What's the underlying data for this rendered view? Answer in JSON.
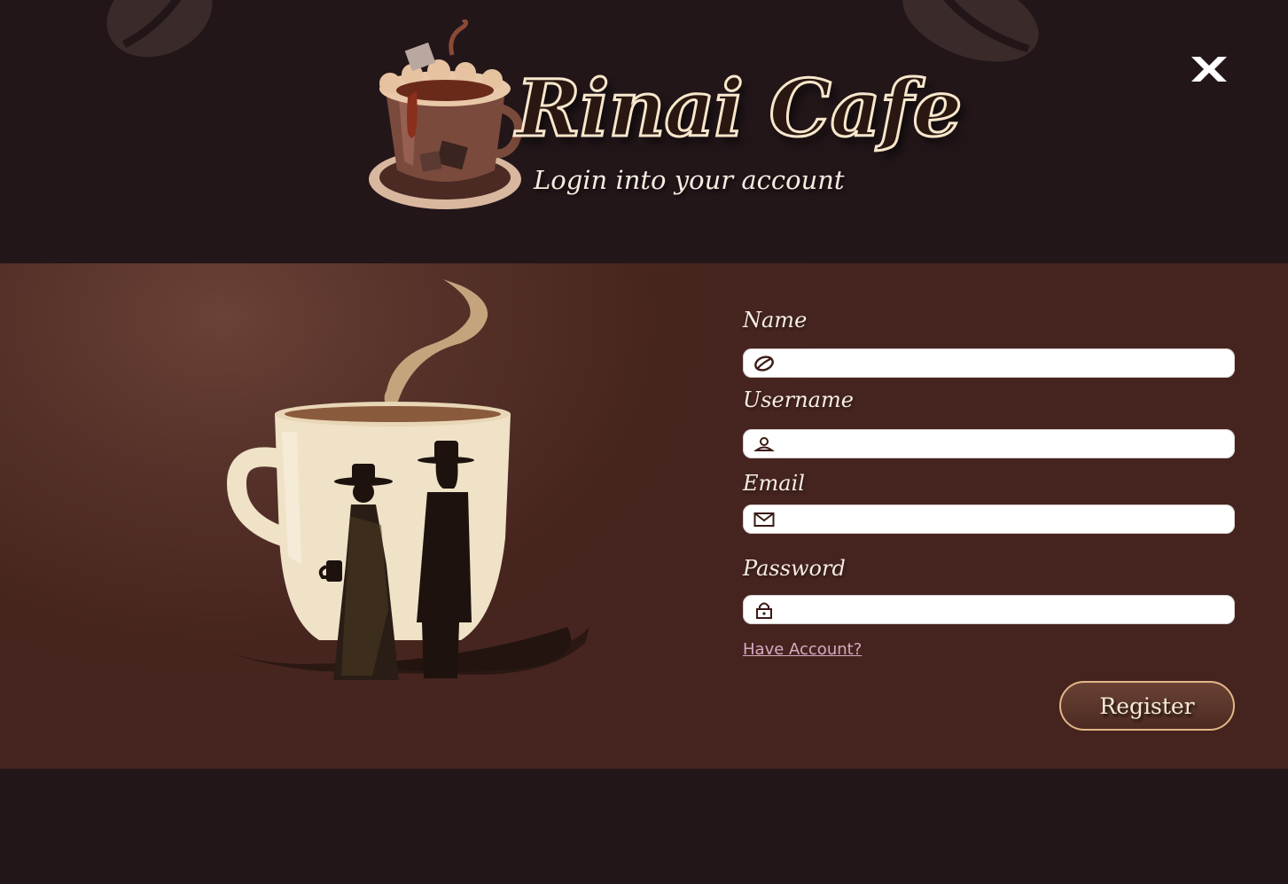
{
  "header": {
    "brand_title": "Rinai Cafe",
    "subtitle": "Login into your account",
    "close_icon": "close-x-icon"
  },
  "form": {
    "fields": [
      {
        "label": "Name",
        "icon": "coffee-bean-icon",
        "value": ""
      },
      {
        "label": "Username",
        "icon": "user-icon",
        "value": ""
      },
      {
        "label": "Email",
        "icon": "envelope-icon",
        "value": ""
      },
      {
        "label": "Password",
        "icon": "lock-icon",
        "value": ""
      }
    ],
    "have_account_link": "Have Account?",
    "register_button": "Register"
  },
  "colors": {
    "page_background": "#221619",
    "band_background": "#47251f",
    "link": "#d7a9c4",
    "button_border": "#e3b687"
  }
}
